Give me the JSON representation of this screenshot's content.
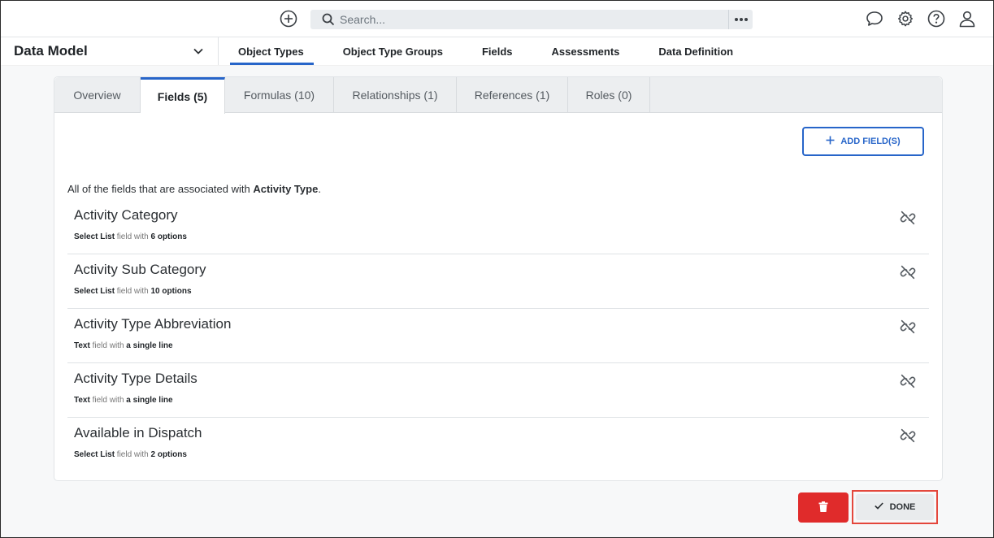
{
  "header": {
    "search_placeholder": "Search...",
    "icons": [
      "add-circle-icon",
      "search-icon",
      "more-icon",
      "chat-icon",
      "gear-icon",
      "help-icon",
      "user-icon"
    ]
  },
  "module": {
    "title": "Data Model"
  },
  "nav": {
    "tabs": [
      {
        "label": "Object Types"
      },
      {
        "label": "Object Type Groups"
      },
      {
        "label": "Fields"
      },
      {
        "label": "Assessments"
      },
      {
        "label": "Data Definition"
      }
    ]
  },
  "subtabs": [
    {
      "label": "Overview"
    },
    {
      "label": "Fields (5)"
    },
    {
      "label": "Formulas (10)"
    },
    {
      "label": "Relationships (1)"
    },
    {
      "label": "References (1)"
    },
    {
      "label": "Roles (0)"
    }
  ],
  "add_button": {
    "label": "ADD FIELD(S)"
  },
  "description": {
    "prefix": "All of the fields that are associated with ",
    "object_name": "Activity Type",
    "suffix": "."
  },
  "fields": [
    {
      "name": "Activity Category",
      "type": "Select List",
      "mid": " field with ",
      "detail": "6 options"
    },
    {
      "name": "Activity Sub Category",
      "type": "Select List",
      "mid": " field with ",
      "detail": "10 options"
    },
    {
      "name": "Activity Type Abbreviation",
      "type": "Text",
      "mid": " field with ",
      "detail": "a single line"
    },
    {
      "name": "Activity Type Details",
      "type": "Text",
      "mid": " field with ",
      "detail": "a single line"
    },
    {
      "name": "Available in Dispatch",
      "type": "Select List",
      "mid": " field with ",
      "detail": "2 options"
    }
  ],
  "footer": {
    "done_label": "DONE"
  },
  "colors": {
    "accent": "#2765c9",
    "danger": "#e02b2b",
    "highlight": "#e4473c"
  }
}
